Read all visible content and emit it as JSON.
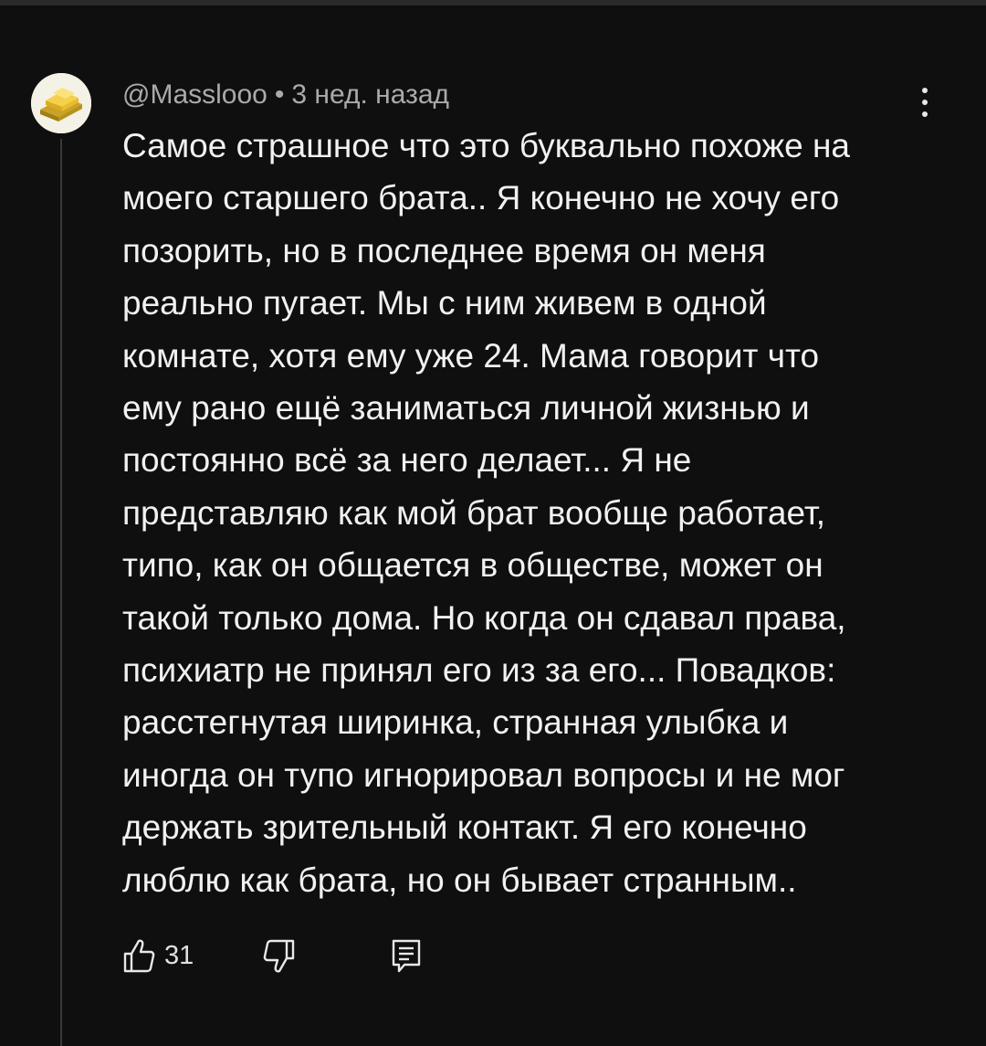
{
  "comment": {
    "author": "@Masslooo",
    "separator": "•",
    "timestamp": "3 нед. назад",
    "lines": [
      "Самое страшное что это буквально похоже на",
      "моего старшего брата.. Я конечно не хочу его",
      "позорить, но в последнее время он меня",
      "реально пугает. Мы с ним живем в одной",
      "комнате, хотя ему уже 24. Мама говорит что",
      "ему рано ещё заниматься личной жизнью и",
      "постоянно всё за него делает... Я не",
      "представляю как мой брат вообще работает,",
      "типо, как он общается в обществе, может он",
      "такой только дома. Но когда он сдавал права,",
      "психиатр не принял его из за его... Повадков:",
      "расстегнутая ширинка, странная улыбка и",
      "иногда он тупо игнорировал вопросы и не мог",
      "держать зрительный контакт. Я его конечно",
      "люблю как брата, но он бывает странным.."
    ]
  },
  "actions": {
    "like_count": "31",
    "like_icon": "thumbs-up-icon",
    "dislike_icon": "thumbs-down-icon",
    "reply_icon": "comment-reply-icon",
    "more_icon": "more-vertical-icon"
  },
  "colors": {
    "background": "#0f0f0f",
    "text_primary": "#f1f1f1",
    "text_secondary": "#aaaaaa"
  }
}
